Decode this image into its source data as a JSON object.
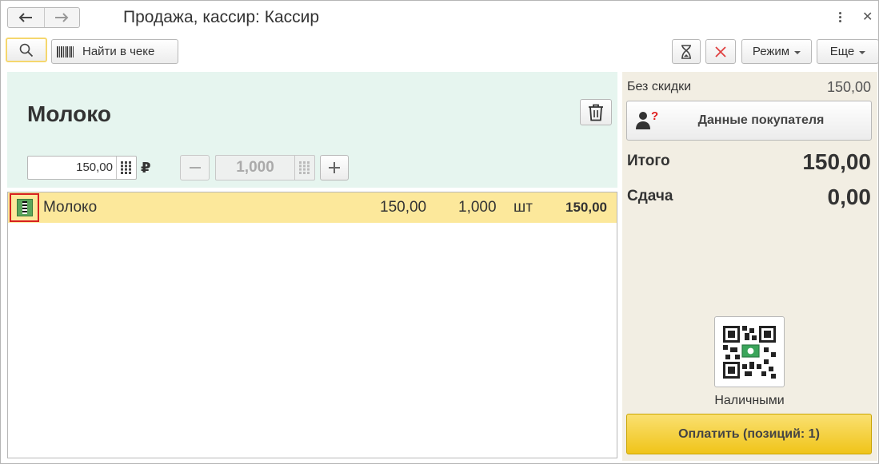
{
  "window": {
    "title": "Продажа, кассир: Кассир"
  },
  "toolbar": {
    "find_label": "Найти в чеке",
    "mode_label": "Режим",
    "more_label": "Еще"
  },
  "product": {
    "name": "Молоко",
    "price": "150,00",
    "currency": "₽",
    "quantity": "1,000"
  },
  "items": [
    {
      "name": "Молоко",
      "price": "150,00",
      "qty": "1,000",
      "unit": "шт",
      "sum": "150,00"
    }
  ],
  "summary": {
    "no_discount_label": "Без скидки",
    "no_discount_value": "150,00",
    "buyer_label": "Данные покупателя",
    "total_label": "Итого",
    "total_value": "150,00",
    "change_label": "Сдача",
    "change_value": "0,00",
    "payment_method_label": "Наличными",
    "pay_button_label": "Оплатить (позиций: 1)"
  },
  "colors": {
    "product_panel_bg": "#e6f5ef",
    "selected_row_bg": "#fce89b",
    "summary_bg": "#f2eee3",
    "pay_button": "#f0c419",
    "highlight_border": "#d62020"
  }
}
